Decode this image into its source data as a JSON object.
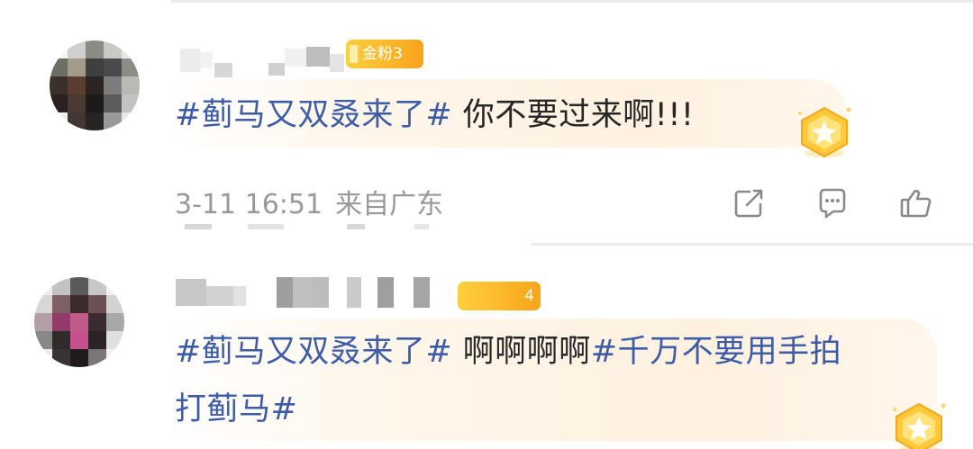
{
  "comments": [
    {
      "fan_badge": "金粉3",
      "text_topic": "#蓟马又双叒来了#",
      "text_rest": " 你不要过来啊!!!",
      "date": "3-11 16:51",
      "location": "来自广东",
      "actions": {
        "share_icon": "share-icon",
        "reply_icon": "comment-icon",
        "like_icon": "thumbs-up-icon"
      }
    },
    {
      "fan_badge_number": "4",
      "line1_topic": "#蓟马又双叒来了#",
      "line1_rest": " 啊啊啊啊",
      "line1_topic2": "#千万不要用手拍",
      "line2_topic": "打蓟马#"
    }
  ],
  "colors": {
    "topic": "#3e5da6",
    "text": "#262626",
    "meta": "#999999",
    "badge": "#f8a41c"
  }
}
